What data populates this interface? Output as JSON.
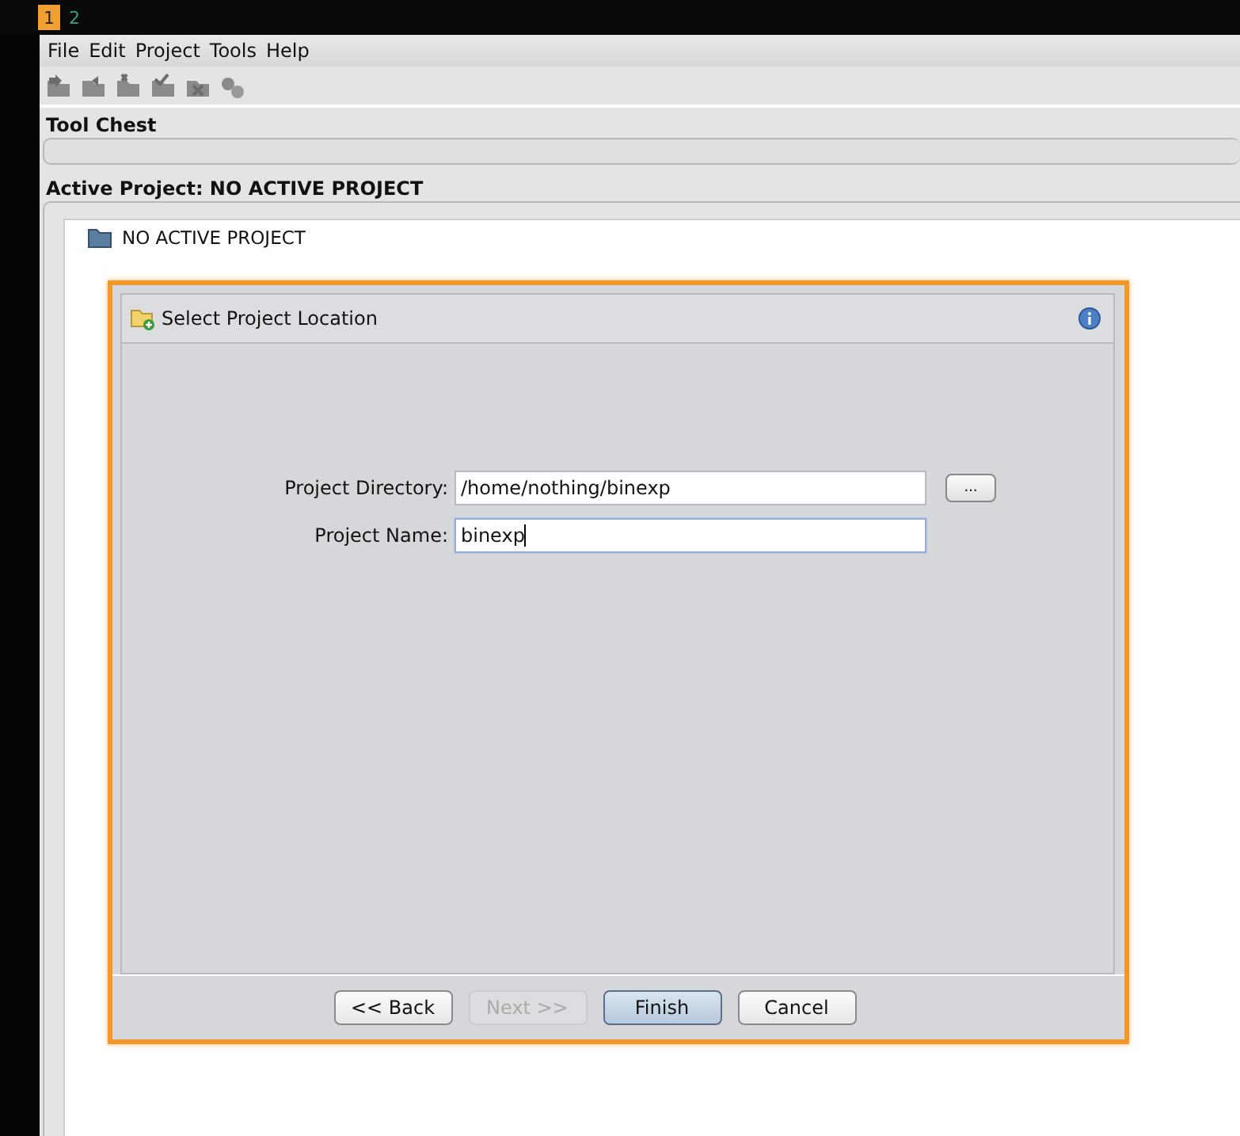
{
  "workspaces": [
    {
      "label": "1",
      "selected": true
    },
    {
      "label": "2",
      "selected": false
    }
  ],
  "menu": [
    "File",
    "Edit",
    "Project",
    "Tools",
    "Help"
  ],
  "tool_chest": {
    "title": "Tool Chest"
  },
  "active_project": {
    "title": "Active Project: NO ACTIVE PROJECT",
    "tree_item": "NO ACTIVE PROJECT"
  },
  "dialog": {
    "title": "Select Project Location",
    "fields": [
      {
        "label": "Project Directory:",
        "value": "/home/nothing/binexp",
        "focused": false,
        "browse": "..."
      },
      {
        "label": "Project Name:",
        "value": "binexp",
        "focused": true
      }
    ],
    "buttons": [
      {
        "label": "<< Back",
        "disabled": false,
        "default": false
      },
      {
        "label": "Next >>",
        "disabled": true,
        "default": false
      },
      {
        "label": "Finish",
        "disabled": false,
        "default": true
      },
      {
        "label": "Cancel",
        "disabled": false,
        "default": false
      }
    ]
  }
}
